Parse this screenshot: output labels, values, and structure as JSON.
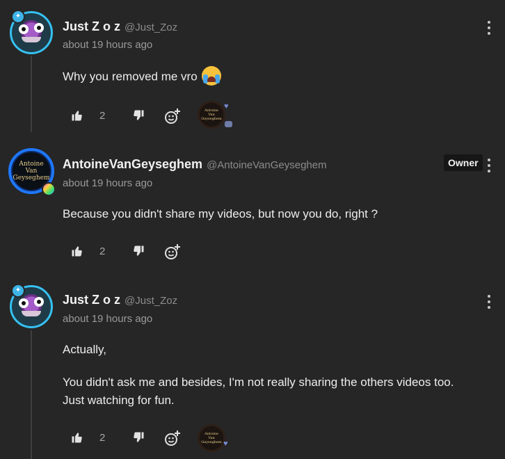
{
  "comments": [
    {
      "username": "Just Z o z",
      "handle": "@Just_Zoz",
      "time": "about 19 hours ago",
      "body": [
        "Why you removed me vro"
      ],
      "emoji_icon": "loudly-crying-face-emoji",
      "likes": "2",
      "has_reactions": true
    },
    {
      "username": "AntoineVanGeyseghem",
      "handle": "@AntoineVanGeyseghem",
      "time": "about 19 hours ago",
      "role_badge": "Owner",
      "body": [
        "Because you didn't share my videos, but now you do, right ?"
      ],
      "avatar_text": [
        "Antoine",
        "Van",
        "Geyseghem"
      ],
      "likes": "2",
      "has_reactions": false
    },
    {
      "username": "Just Z o z",
      "handle": "@Just_Zoz",
      "time": "about 19 hours ago",
      "body": [
        "Actually,",
        "You didn't ask me and besides, I'm not really sharing the others videos too.",
        "Just watching for fun."
      ],
      "likes": "2",
      "has_reactions": true
    }
  ],
  "reaction_avatar_text": [
    "Antoine",
    "Van",
    "Geyseghem"
  ],
  "icons": {
    "like": "thumbs-up-icon",
    "dislike": "thumbs-down-icon",
    "react": "add-reaction-icon",
    "menu": "more-vertical-icon",
    "heart": "heart-icon",
    "comment": "speech-bubble-icon"
  },
  "colors": {
    "background": "#262626",
    "zoz_ring": "#35c1f1",
    "antoine_ring": "#1e78ff",
    "reaction_heart": "#7b8bd6"
  }
}
